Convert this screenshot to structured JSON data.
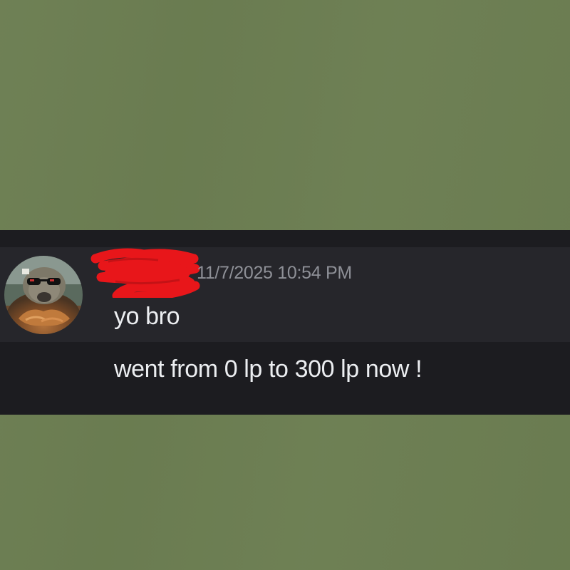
{
  "colors": {
    "page_background": "#6c7e52",
    "chat_background": "#1c1c20",
    "hover_row_background": "#26262b",
    "timestamp_color": "#8e9097",
    "message_text_color": "#eceef1",
    "redaction_color": "#e8161a"
  },
  "message": {
    "avatar_icon": "otter-with-sunglasses-avatar",
    "username_redacted": true,
    "timestamp": "11/7/2025 10:54 PM",
    "lines": [
      "yo bro",
      "went from 0 lp to 300 lp now !"
    ]
  }
}
